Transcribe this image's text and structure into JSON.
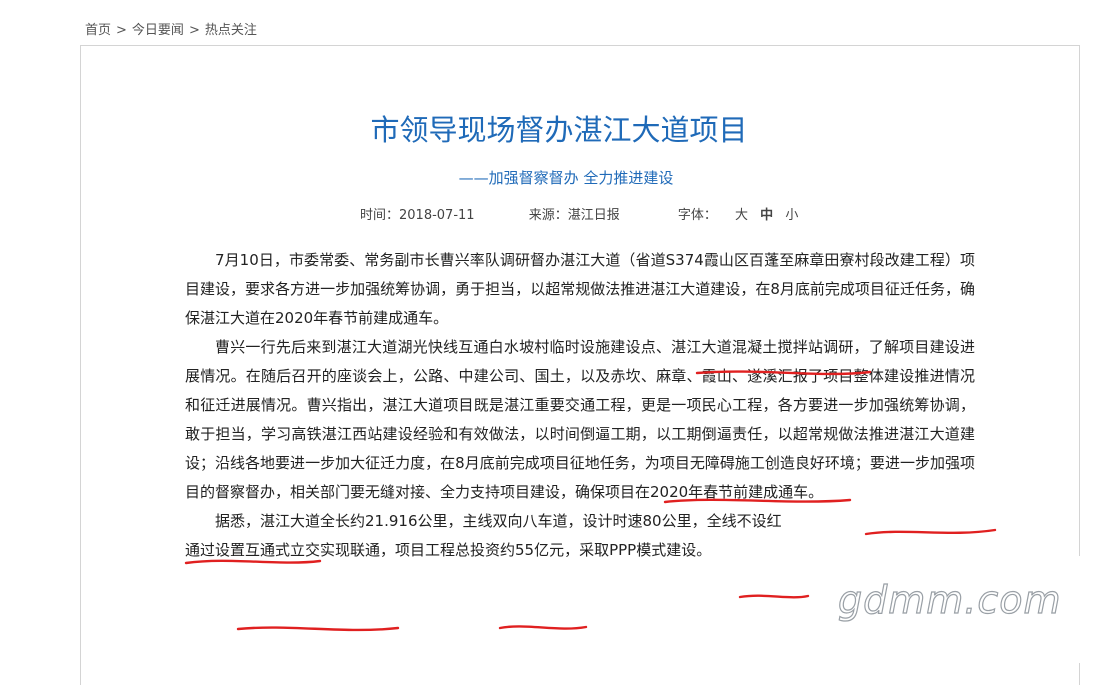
{
  "breadcrumb": {
    "home": "首页",
    "sep": ">",
    "news": "今日要闻",
    "current": "热点关注"
  },
  "article": {
    "title": "市领导现场督办湛江大道项目",
    "subtitle": "——加强督察督办 全力推进建设",
    "meta": {
      "date": "时间：2018-07-11",
      "source": "来源：湛江日报",
      "font_label": "字体：",
      "font_large": "大",
      "font_medium": "中",
      "font_small": "小"
    },
    "paragraphs": [
      "7月10日，市委常委、常务副市长曹兴率队调研督办湛江大道（省道S374霞山区百蓬至麻章田寮村段改建工程）项目建设，要求各方进一步加强统筹协调，勇于担当，以超常规做法推进湛江大道建设，在8月底前完成项目征迁任务，确保湛江大道在2020年春节前建成通车。",
      "曹兴一行先后来到湛江大道湖光快线互通白水坡村临时设施建设点、湛江大道混凝土搅拌站调研，了解项目建设进展情况。在随后召开的座谈会上，公路、中建公司、国土，以及赤坎、麻章、霞山、遂溪汇报了项目整体建设推进情况和征迁进展情况。曹兴指出，湛江大道项目既是湛江重要交通工程，更是一项民心工程，各方要进一步加强统筹协调，敢于担当，学习高铁湛江西站建设经验和有效做法，以时间倒逼工期，以工期倒逼责任，以超常规做法推进湛江大道建设；沿线各地要进一步加大征迁力度，在8月底前完成项目征地任务，为项目无障碍施工创造良好环境；要进一步加强项目的督察督办，相关部门要无缝对接、全力支持项目建设，确保项目在2020年春节前建成通车。",
      "据悉，湛江大道全长约21.916公里，主线双向八车道，设计时速80公里，全线不设红",
      "通过设置互通式立交实现联通，项目工程总投资约55亿元，采取PPP模式建设。"
    ]
  },
  "watermark": "gdmm.com",
  "colors": {
    "title": "#1f6ab8",
    "underline": "#e02020",
    "border": "#d4d4d4"
  }
}
